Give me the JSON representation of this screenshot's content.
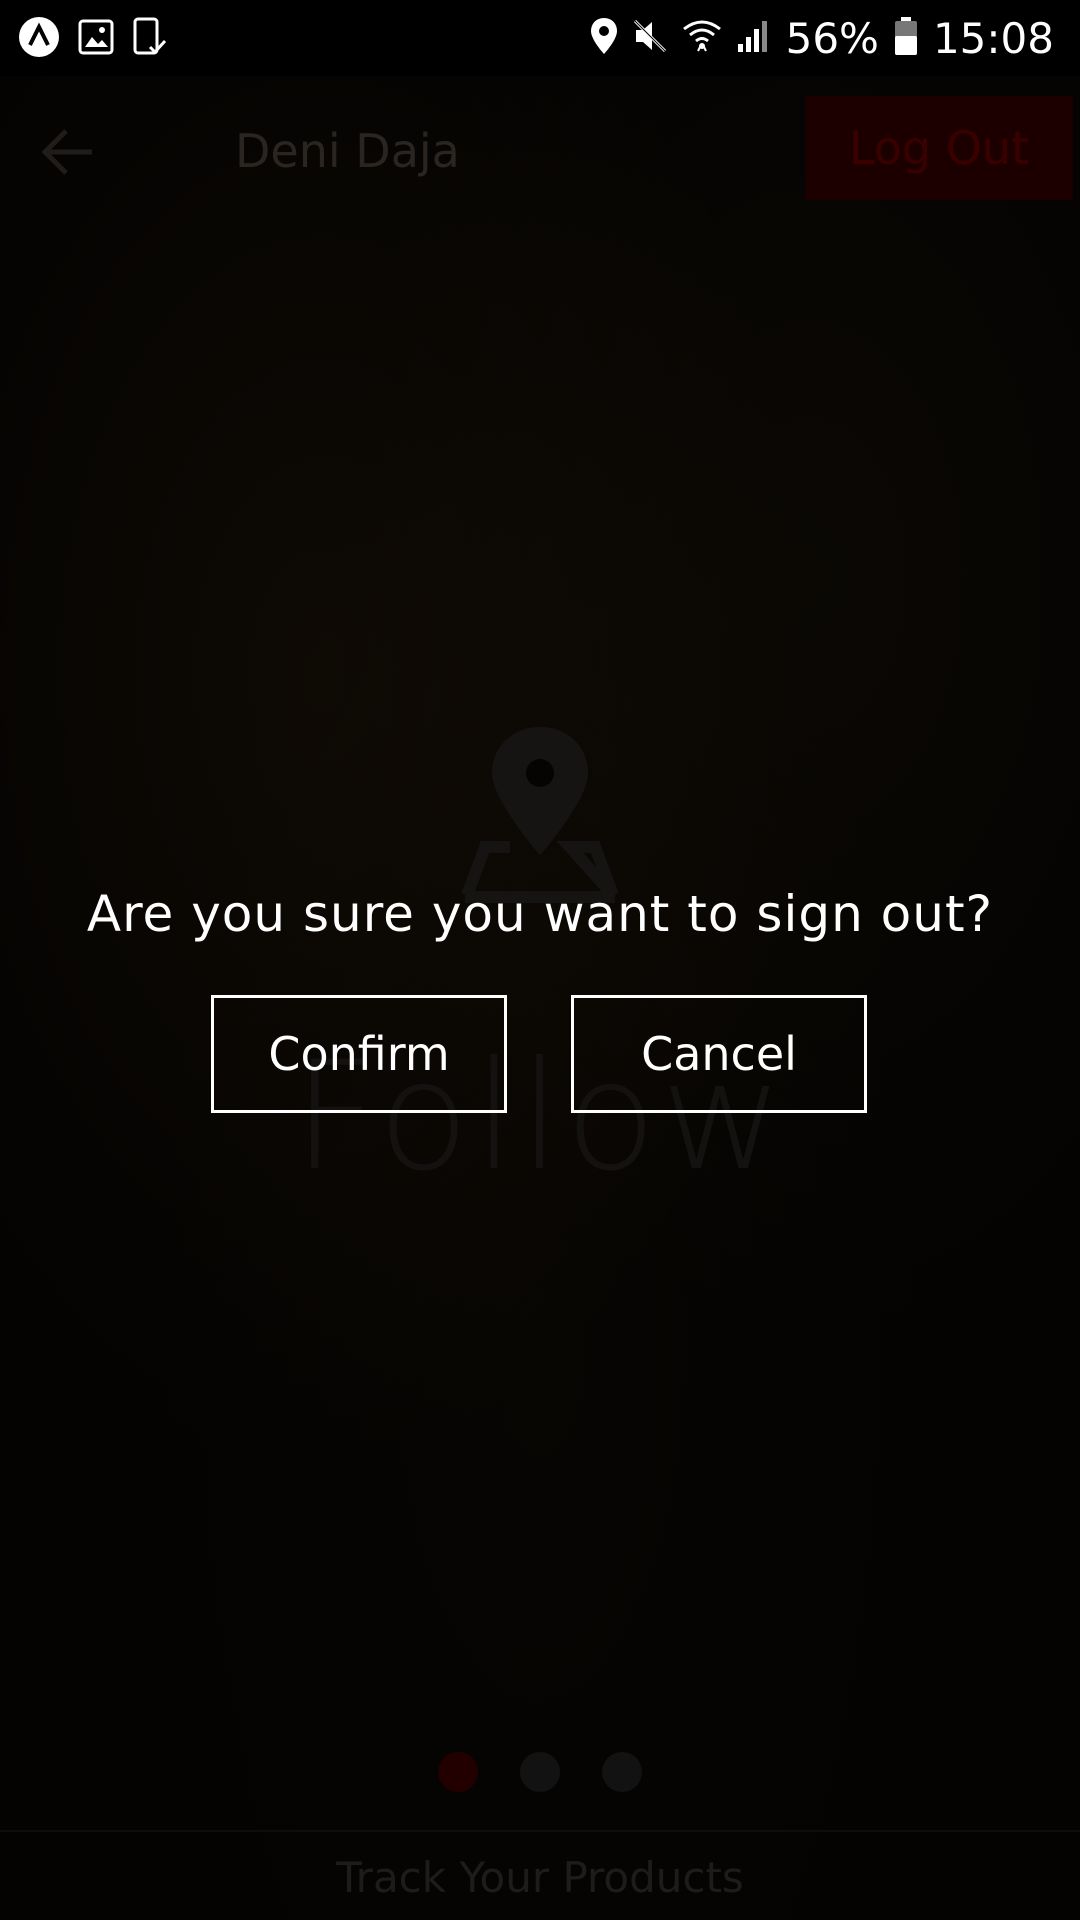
{
  "status_bar": {
    "battery_percent": "56%",
    "time": "15:08",
    "icons_left": [
      "app-notification-icon",
      "gallery-icon",
      "device-check-icon"
    ],
    "icons_right": [
      "location-icon",
      "mute-icon",
      "wifi-icon",
      "signal-icon",
      "battery-icon"
    ]
  },
  "header": {
    "title": "Deni Daja",
    "logout_label": "Log Out"
  },
  "logo": {
    "word": "Follow"
  },
  "dialog": {
    "question": "Are you sure you want to sign out?",
    "confirm_label": "Confirm",
    "cancel_label": "Cancel"
  },
  "pager": {
    "count": 3,
    "active_index": 0
  },
  "bottom": {
    "label": "Track Your Products"
  },
  "colors": {
    "dialog_text": "#ffffff",
    "logout_bg": "#1c0000",
    "overlay": "#000000"
  }
}
